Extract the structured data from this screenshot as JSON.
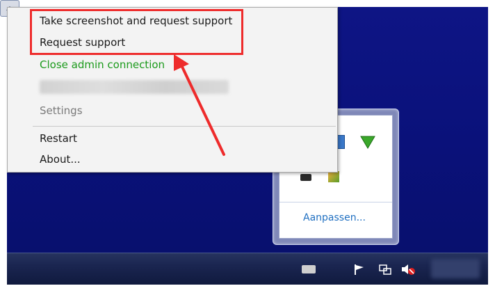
{
  "context_menu": {
    "items": [
      {
        "label": "Take screenshot and request support"
      },
      {
        "label": "Request support"
      },
      {
        "label": "Close admin connection"
      },
      {
        "label": ""
      },
      {
        "label": "Settings"
      },
      {
        "label": "Restart"
      },
      {
        "label": "About..."
      }
    ]
  },
  "tray_popup": {
    "customize_label": "Aanpassen..."
  },
  "colors": {
    "highlight": "#ee2b2b",
    "admin_connection": "#1b9a1b",
    "desktop": "#0e1585",
    "link": "#1f6fc1"
  },
  "icons": {
    "tray": [
      "green-triangle-icon",
      "blue-device-icon",
      "shield-icon",
      "remote-icon"
    ],
    "taskbar": [
      "keyboard-icon",
      "chevron-up-icon",
      "flag-icon",
      "network-icon",
      "volume-muted-icon"
    ]
  }
}
